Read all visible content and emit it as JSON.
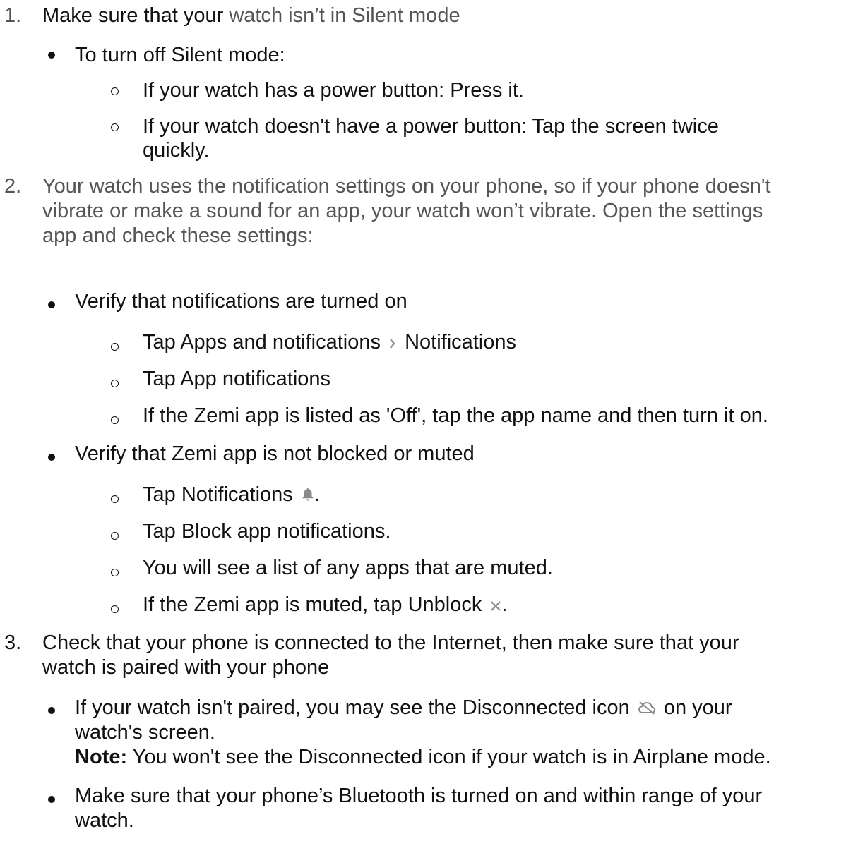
{
  "steps": [
    {
      "number": "1.",
      "text_dark": "Make sure that your",
      "text_gray": "watch isn’t in Silent mode",
      "bullets": [
        {
          "text": "To turn off Silent mode:",
          "subs": [
            "If your watch has a power button: Press it.",
            "If your watch doesn't have a power button: Tap the screen twice",
            "quickly."
          ]
        }
      ]
    },
    {
      "number": "2.",
      "lines": [
        "Your watch uses the notification settings on your phone, so if your phone doesn't",
        "vibrate or make a sound for an app, your watch won’t vibrate.  Open the settings",
        "app and check these settings:"
      ],
      "bullets": [
        {
          "text": "Verify that notifications are turned on",
          "subs": [
            {
              "before": "Tap Apps and notifications",
              "icon": "chevron-right-icon",
              "after": "Notifications"
            },
            "Tap App notifications",
            "If the Zemi app is listed as 'Off', tap the app name and then turn it on."
          ]
        },
        {
          "text": "Verify that Zemi app is not blocked or muted",
          "subs": [
            {
              "before": "Tap Notifications",
              "icon": "bell-icon",
              "after": "."
            },
            "Tap Block app notifications.",
            "You will see a list of any apps that are muted.",
            {
              "before": "If the Zemi app is muted, tap Unblock",
              "icon": "close-icon",
              "after": "."
            }
          ]
        }
      ]
    },
    {
      "number": "3.",
      "lines": [
        "Check that your phone is connected to the Internet, then make sure that your",
        "watch is paired with your phone"
      ],
      "bullets": [
        {
          "lines": [
            {
              "before": "If your watch isn't paired, you may see the Disconnected icon",
              "icon": "cloud-off-icon",
              "after": "on your"
            },
            "watch's screen."
          ],
          "note_label": "Note:",
          "note_text": "You won't see the Disconnected icon if your watch is in Airplane mode."
        },
        {
          "lines": [
            "Make sure that your phone’s Bluetooth is turned on and within range of your",
            "watch."
          ]
        }
      ]
    }
  ],
  "colors": {
    "text": "#111111",
    "gray_text": "#555555",
    "icon": "#8a8a8a"
  }
}
